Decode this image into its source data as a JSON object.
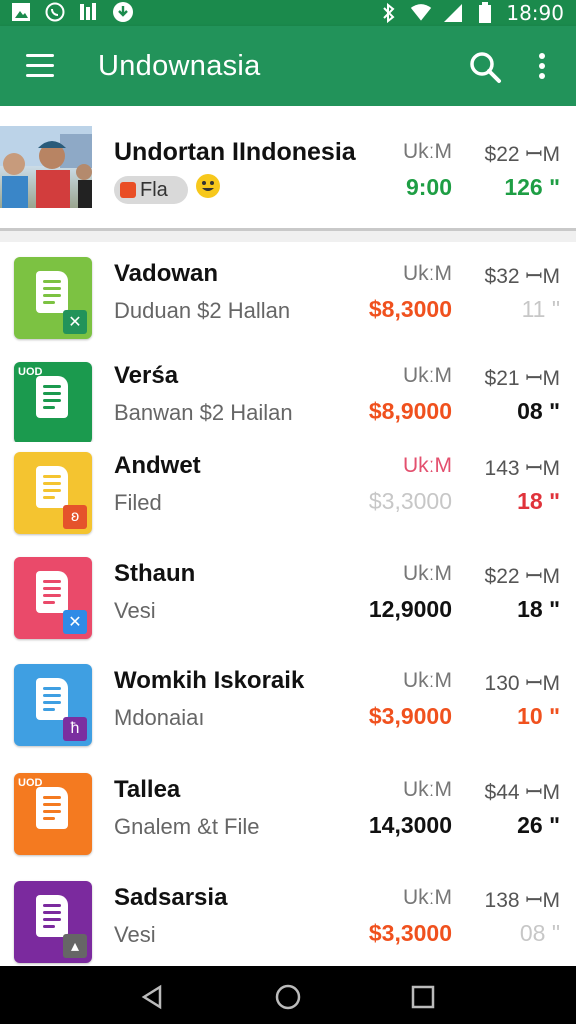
{
  "status_bar": {
    "time": "18:90",
    "left_icons": [
      "image-notification-icon",
      "whatsapp-icon",
      "signal-bars-icon",
      "download-icon"
    ],
    "right_icons": [
      "bluetooth-icon",
      "wifi-icon",
      "cell-signal-icon",
      "battery-icon"
    ]
  },
  "app_bar": {
    "title": "Undownasia",
    "menu_icon": "hamburger-menu-icon",
    "search_icon": "search-icon",
    "more_icon": "more-vertical-icon"
  },
  "featured": {
    "name": "Undortan IIndonesia",
    "chip_label": "Fla",
    "unit": "UkːM",
    "price": "$22 ꟷM",
    "val_a": "9:00",
    "val_b": "126 ʺ"
  },
  "items": [
    {
      "name": "Vadowan",
      "sub": "Duduan $2 Hallan",
      "unit": "UkːM",
      "price": "$32 ꟷM",
      "val_a": "$8,3000",
      "val_b": "11 ʺ",
      "icon_color": "#7cc242",
      "badge": "✕",
      "badge_color": "#22935a",
      "val_a_style": "orange",
      "val_b_style": "faded"
    },
    {
      "name": "Verśa",
      "sub": "Banwan $2 Hailan",
      "unit": "UkːM",
      "price": "$21 ꟷM",
      "val_a": "$8,9000",
      "val_b": "08 ʺ",
      "icon_color": "#1b9a4e",
      "badge": "",
      "badge_color": "#1b9a4e",
      "val_a_style": "orange",
      "val_b_style": "black",
      "icon_label": "UOD"
    },
    {
      "name": "Andwet",
      "sub": "Filed",
      "unit": "UkːM",
      "price": "143 ꟷM",
      "val_a": "$3,3000",
      "val_b": "18 ʺ",
      "icon_color": "#f4c430",
      "badge": "ʚ",
      "badge_color": "#e5532b",
      "val_a_style": "faded",
      "val_b_style": "red"
    },
    {
      "name": "Sthaun",
      "sub": "Vesi",
      "unit": "UkːM",
      "price": "$22 ꟷM",
      "val_a": "12,9000",
      "val_b": "18 ʺ",
      "icon_color": "#ea4a6a",
      "badge": "✕",
      "badge_color": "#2f8be6",
      "val_a_style": "black",
      "val_b_style": "black"
    },
    {
      "name": "Womkih Iskoraik",
      "sub": "Mdonaiaı",
      "unit": "UkːM",
      "price": "130 ꟷM",
      "val_a": "$3,9000",
      "val_b": "10 ʺ",
      "icon_color": "#3f9fe2",
      "badge": "ħ",
      "badge_color": "#7b2fa0",
      "val_a_style": "orange",
      "val_b_style": "orange"
    },
    {
      "name": "Tallea",
      "sub": "Gnalem &t File",
      "unit": "UkːM",
      "price": "$44 ꟷM",
      "val_a": "14,3000",
      "val_b": "26 ʺ",
      "icon_color": "#f47a20",
      "badge": "",
      "badge_color": "#f47a20",
      "val_a_style": "black",
      "val_b_style": "black",
      "icon_label": "UOD"
    },
    {
      "name": "Sadsarsia",
      "sub": "Vesi",
      "unit": "UkːM",
      "price": "138 ꟷM",
      "val_a": "$3,3000",
      "val_b": "08 ʺ",
      "icon_color": "#7b2a9e",
      "badge": "▴",
      "badge_color": "#666666",
      "val_a_style": "orange",
      "val_b_style": "faded"
    }
  ]
}
